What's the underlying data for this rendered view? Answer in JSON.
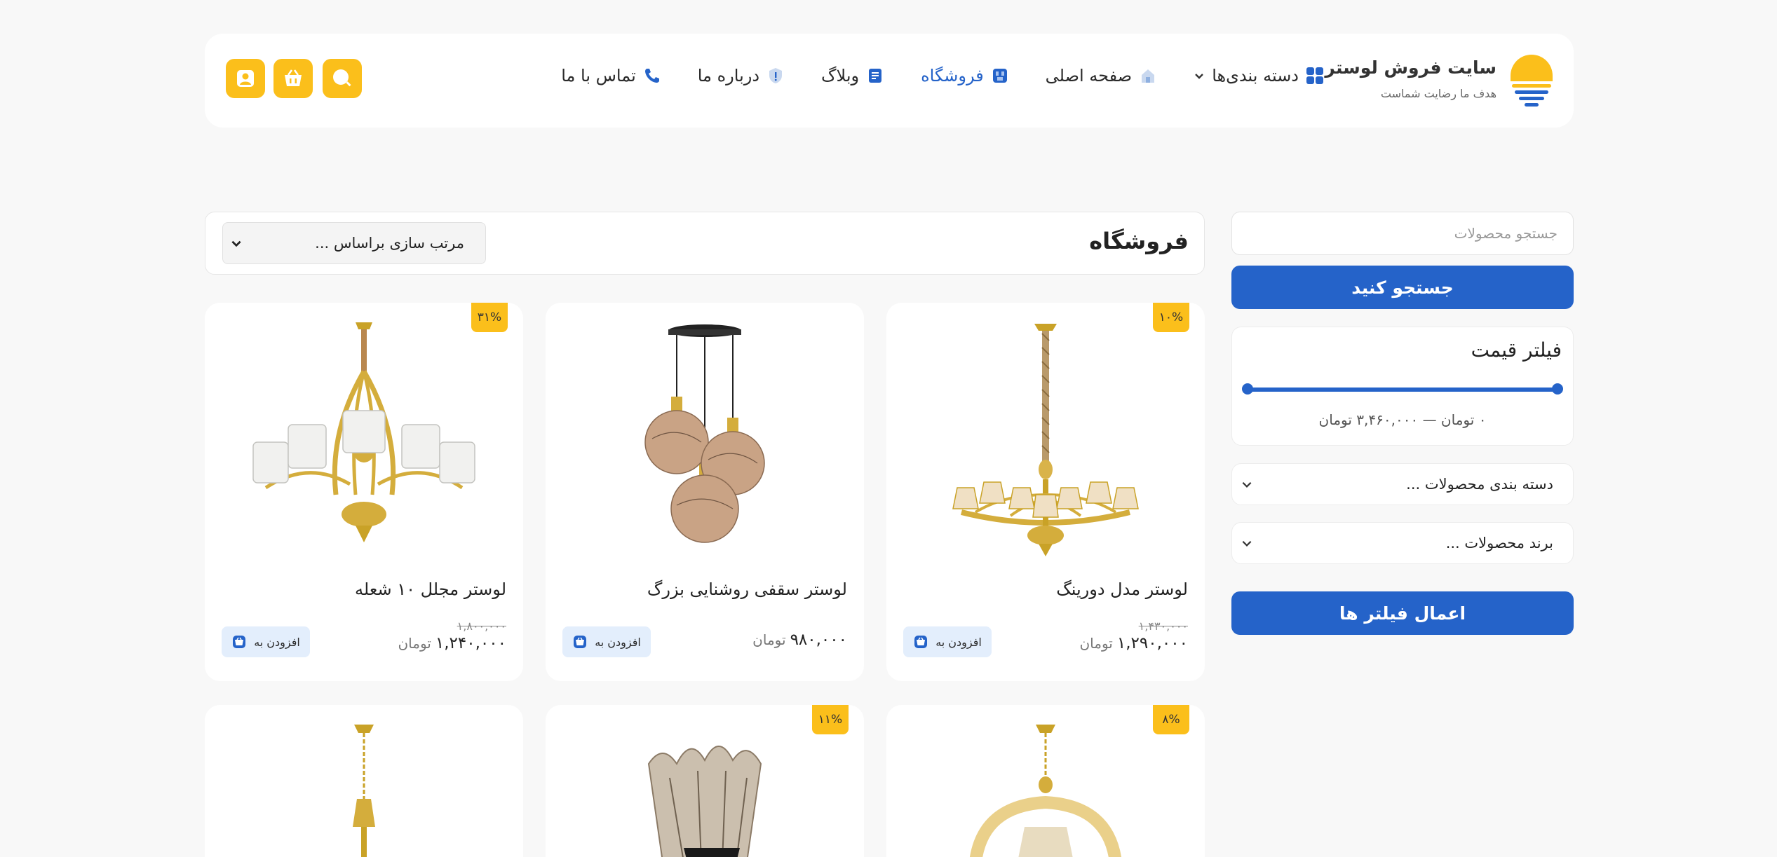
{
  "header": {
    "brand_title": "سایت فروش لوستر",
    "brand_tagline": "هدف ما رضایت شماست",
    "nav": [
      {
        "label": "دسته بندی‌ها",
        "icon": "grid-icon",
        "active": false
      },
      {
        "label": "صفحه اصلی",
        "icon": "home-icon",
        "active": false
      },
      {
        "label": "فروشگاه",
        "icon": "shop-icon",
        "active": true
      },
      {
        "label": "وبلاگ",
        "icon": "blog-icon",
        "active": false
      },
      {
        "label": "درباره ما",
        "icon": "info-icon",
        "active": false
      },
      {
        "label": "تماس با ما",
        "icon": "phone-icon",
        "active": false
      }
    ],
    "buttons": [
      "search-icon",
      "basket-icon",
      "user-icon"
    ]
  },
  "sidebar": {
    "search_placeholder": "جستجو محصولات",
    "search_button": "جستجو کنید",
    "price_filter": {
      "title": "فیلتر قیمت",
      "range_text": "۰ تومان — ۳,۴۶۰,۰۰۰ تومان",
      "min_fraction": 0,
      "max_fraction": 1
    },
    "category_dropdown": "دسته بندی محصولات ...",
    "brand_dropdown": "برند محصولات ...",
    "apply_button": "اعمال فیلتر ها"
  },
  "shop": {
    "title": "فروشگاه",
    "sort_placeholder": "مرتب سازی براساس ..."
  },
  "products": [
    {
      "name": "لوستر مدل دورینگ",
      "discount": "۱۰%",
      "old_price": "۱,۴۳۰,۰۰۰",
      "price": "۱,۲۹۰,۰۰۰",
      "unit": "تومان",
      "add_label": "افزودن به"
    },
    {
      "name": "لوستر سقفی روشنایی بزرگ",
      "discount": "",
      "old_price": "",
      "price": "۹۸۰,۰۰۰",
      "unit": "تومان",
      "add_label": "افزودن به"
    },
    {
      "name": "لوستر مجلل ۱۰ شعله",
      "discount": "۳۱%",
      "old_price": "۱,۸۰۰,۰۰۰",
      "price": "۱,۲۴۰,۰۰۰",
      "unit": "تومان",
      "add_label": "افزودن به"
    },
    {
      "discount": "۸%"
    },
    {
      "discount": "۱۱%"
    },
    {
      "discount": ""
    }
  ],
  "colors": {
    "accent": "#2563c9",
    "yellow": "#fbbf1b"
  }
}
